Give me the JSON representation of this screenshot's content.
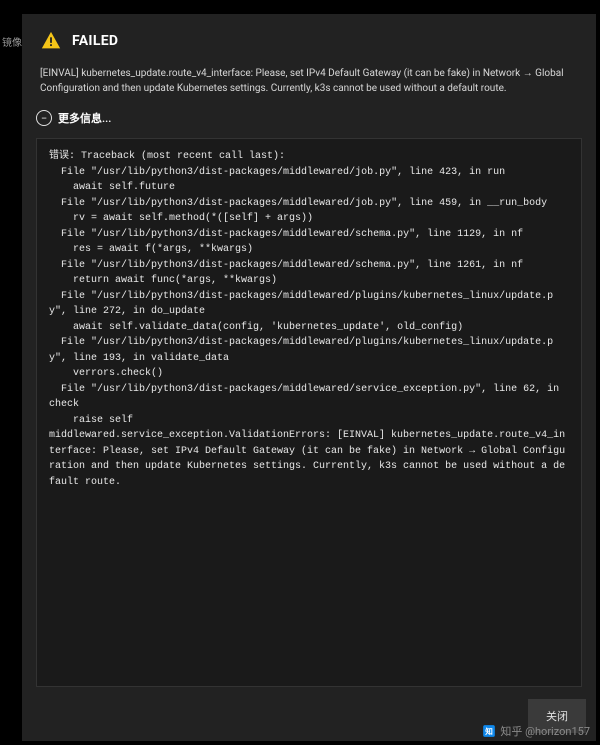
{
  "side_label": "镜像",
  "dialog": {
    "title": "FAILED",
    "description": "[EINVAL] kubernetes_update.route_v4_interface: Please, set IPv4 Default Gateway (it can be fake) in Network → Global Configuration and then update Kubernetes settings. Currently, k3s cannot be used without a default route.",
    "more_info_label": "更多信息...",
    "traceback": "错误: Traceback (most recent call last):\n  File \"/usr/lib/python3/dist-packages/middlewared/job.py\", line 423, in run\n    await self.future\n  File \"/usr/lib/python3/dist-packages/middlewared/job.py\", line 459, in __run_body\n    rv = await self.method(*([self] + args))\n  File \"/usr/lib/python3/dist-packages/middlewared/schema.py\", line 1129, in nf\n    res = await f(*args, **kwargs)\n  File \"/usr/lib/python3/dist-packages/middlewared/schema.py\", line 1261, in nf\n    return await func(*args, **kwargs)\n  File \"/usr/lib/python3/dist-packages/middlewared/plugins/kubernetes_linux/update.py\", line 272, in do_update\n    await self.validate_data(config, 'kubernetes_update', old_config)\n  File \"/usr/lib/python3/dist-packages/middlewared/plugins/kubernetes_linux/update.py\", line 193, in validate_data\n    verrors.check()\n  File \"/usr/lib/python3/dist-packages/middlewared/service_exception.py\", line 62, in check\n    raise self\nmiddlewared.service_exception.ValidationErrors: [EINVAL] kubernetes_update.route_v4_interface: Please, set IPv4 Default Gateway (it can be fake) in Network → Global Configuration and then update Kubernetes settings. Currently, k3s cannot be used without a default route.",
    "close_label": "关闭"
  },
  "watermark": {
    "text": "知乎 @horizon157"
  }
}
